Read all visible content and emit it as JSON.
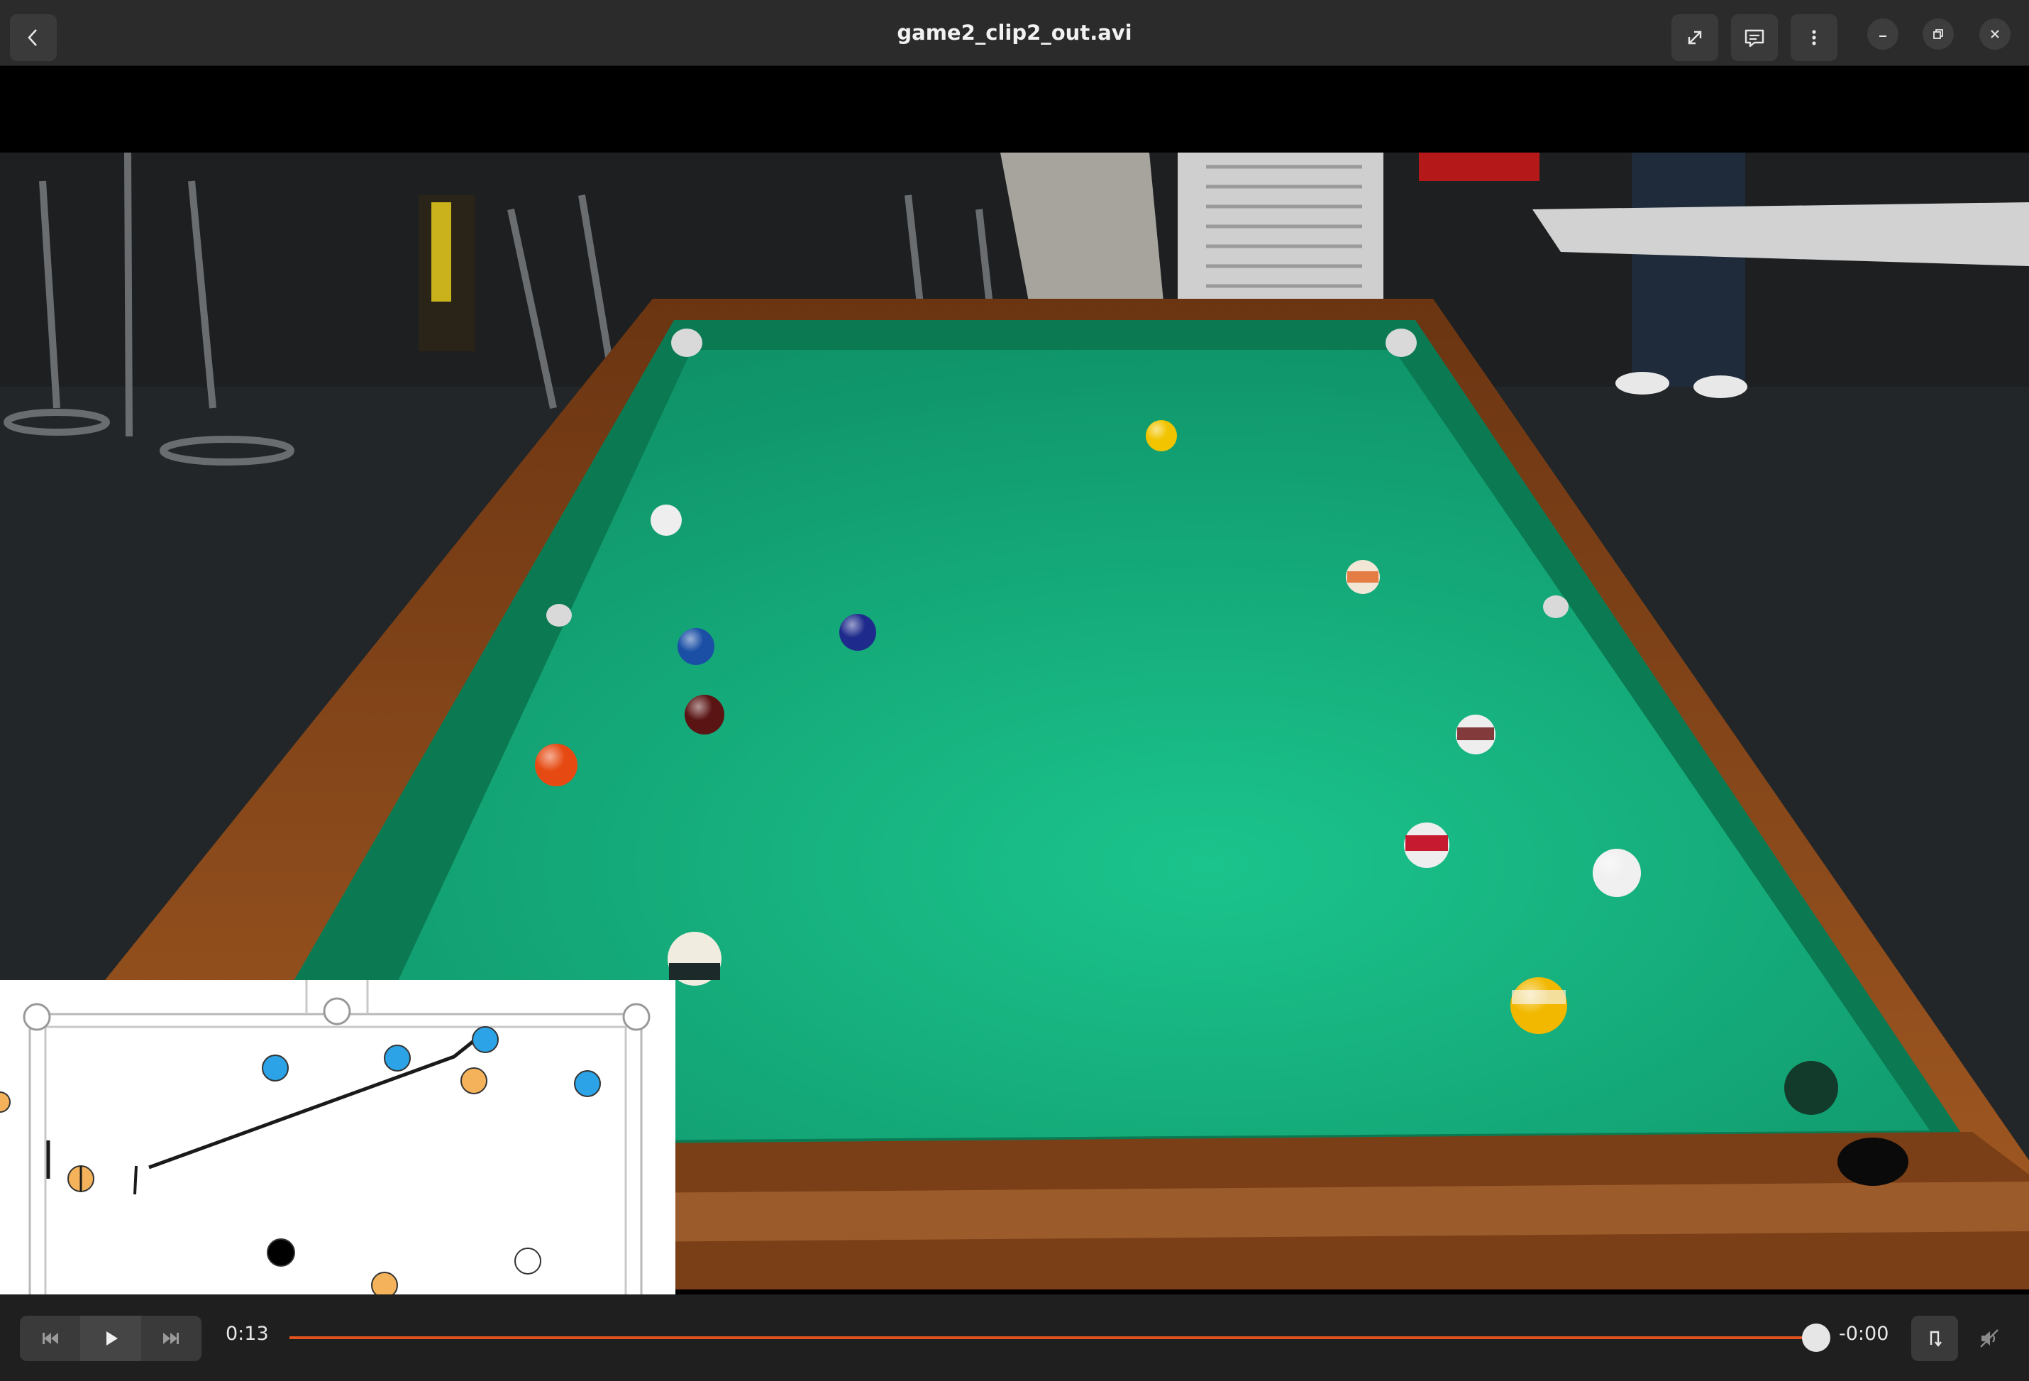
{
  "window": {
    "title": "game2_clip2_out.avi"
  },
  "header": {
    "back_icon": "chevron-left-icon",
    "fullscreen_icon": "expand-icon",
    "subtitles_icon": "subtitles-icon",
    "menu_icon": "vertical-dots-icon",
    "minimize_icon": "minimize-icon",
    "restore_icon": "restore-icon",
    "close_icon": "close-icon"
  },
  "player": {
    "elapsed": "0:13",
    "remaining": "-0:00",
    "progress": 1.0,
    "accent_color": "#e0531d",
    "prev_icon": "skip-back-icon",
    "play_icon": "play-icon",
    "next_icon": "skip-forward-icon",
    "loop_icon": "loop-icon",
    "mute_icon": "volume-muted-icon"
  },
  "colors": {
    "felt": "#16a878",
    "rail_wood": "#8a4a1c",
    "minimap_blue": "#2ba3e6",
    "minimap_orange": "#f4b35a",
    "minimap_black": "#000000"
  }
}
